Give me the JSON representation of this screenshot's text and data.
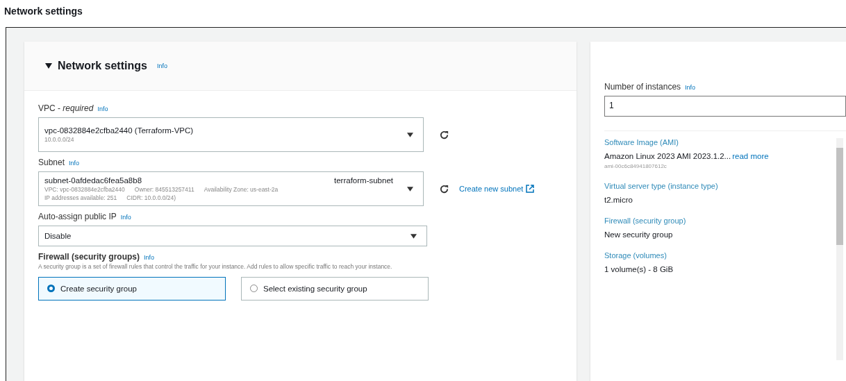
{
  "page_title": "Network settings",
  "section": {
    "title": "Network settings",
    "expanded": true,
    "info": "Info"
  },
  "vpc": {
    "label": "VPC - *required*",
    "info": "Info",
    "value": "vpc-0832884e2cfba2440 (Terraform-VPC)",
    "detail": "10.0.0.0/24"
  },
  "subnet": {
    "label": "Subnet",
    "info": "Info",
    "value": "subnet-0afdedac6fea5a8b8",
    "name": "terraform-subnet",
    "details": [
      [
        "VPC: vpc-0832884e2cfba2440",
        "Owner: 845513257411",
        "Availability Zone: us-east-2a"
      ],
      [
        "IP addresses available: 251",
        "CIDR: 10.0.0.0/24)"
      ]
    ],
    "create_link": "Create new subnet"
  },
  "auto_assign": {
    "label": "Auto-assign public IP",
    "info": "Info",
    "value": "Disable"
  },
  "firewall": {
    "label": "Firewall (security groups)",
    "info": "Info",
    "description": "A security group is a set of firewall rules that control the traffic for your instance. Add rules to allow specific traffic to reach your instance.",
    "options": [
      {
        "label": "Create security group",
        "selected": true
      },
      {
        "label": "Select existing security group",
        "selected": false
      }
    ]
  },
  "summary": {
    "instances": {
      "label": "Number of instances",
      "info": "Info",
      "value": "1"
    },
    "items": [
      {
        "label": "Software Image (AMI)",
        "value": "Amazon Linux 2023 AMI 2023.1.2...",
        "link": "read more",
        "detail": "ami-00c6c84941807612c"
      },
      {
        "label": "Virtual server type (instance type)",
        "value": "t2.micro"
      },
      {
        "label": "Firewall (security group)",
        "value": "New security group"
      },
      {
        "label": "Storage (volumes)",
        "value": "1 volume(s) - 8 GiB"
      }
    ]
  }
}
